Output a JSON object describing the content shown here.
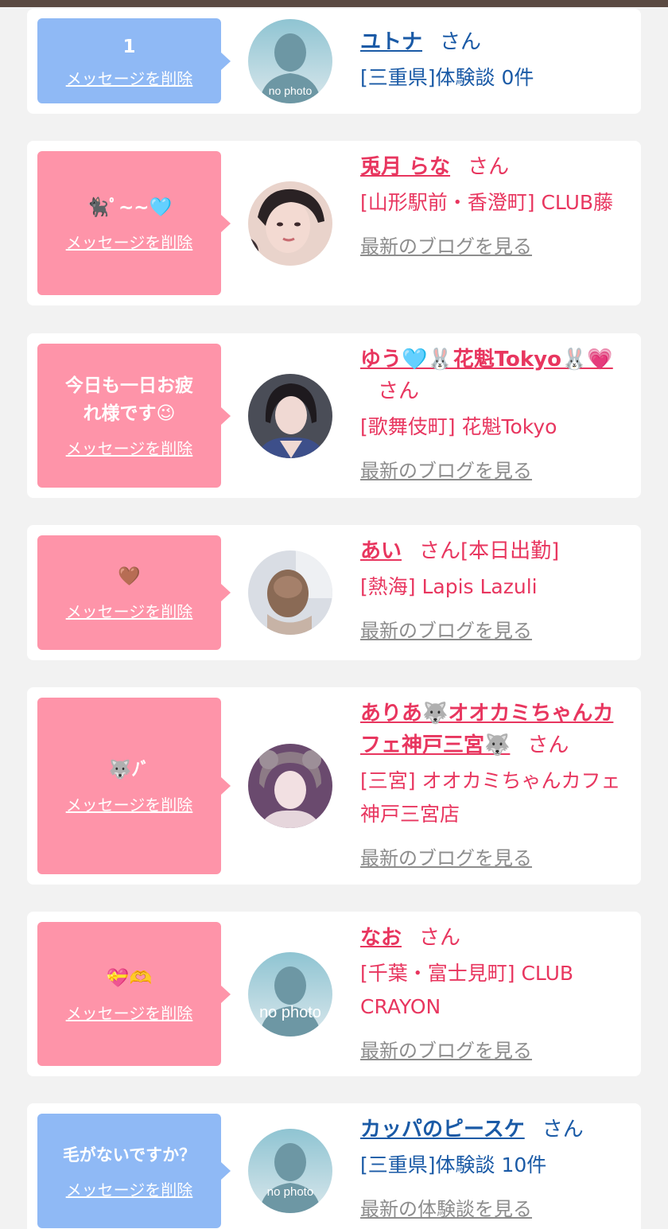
{
  "colors": {
    "blue_bubble": "#8fb9f5",
    "pink_bubble": "#fe94a9",
    "blue_text": "#1a5aa6",
    "pink_text": "#e8365f",
    "link_gray": "#8d8d8d"
  },
  "delete_label": "メッセージを削除",
  "san_label": "さん",
  "entries": [
    {
      "message": "1",
      "name": "ユトナ",
      "detail": "[三重県]体験談 0件",
      "avatar": "no photo"
    },
    {
      "message": "🐈‍⬛ﾟ~~🩵",
      "name": "兎月 らな",
      "detail": "[山形駅前・香澄町] CLUB藤",
      "link": "最新のブログを見る"
    },
    {
      "message": "今日も一日お疲れ様です😉",
      "name": "ゆう🩵🐰花魁Tokyo🐰💗",
      "detail": "[歌舞伎町] 花魁Tokyo",
      "link": "最新のブログを見る"
    },
    {
      "message": "🤎",
      "name": "あい",
      "suffix": "[本日出勤]",
      "detail": "[熱海] Lapis Lazuli",
      "link": "最新のブログを見る"
    },
    {
      "message": "🐺ﾉﾞ",
      "name": "ありあ🐺オオカミちゃんカフェ神戸三宮🐺",
      "detail": "[三宮] オオカミちゃんカフェ神戸三宮店",
      "link": "最新のブログを見る"
    },
    {
      "message": "💝🫶",
      "name": "なお",
      "detail": "[千葉・富士見町] CLUB CRAYON",
      "link": "最新のブログを見る",
      "avatar": "no photo"
    },
    {
      "message": "毛がないですか？",
      "name": "カッパのピースケ",
      "detail": "[三重県]体験談 10件",
      "link": "最新の体験談を見る",
      "avatar": "no photo"
    }
  ]
}
